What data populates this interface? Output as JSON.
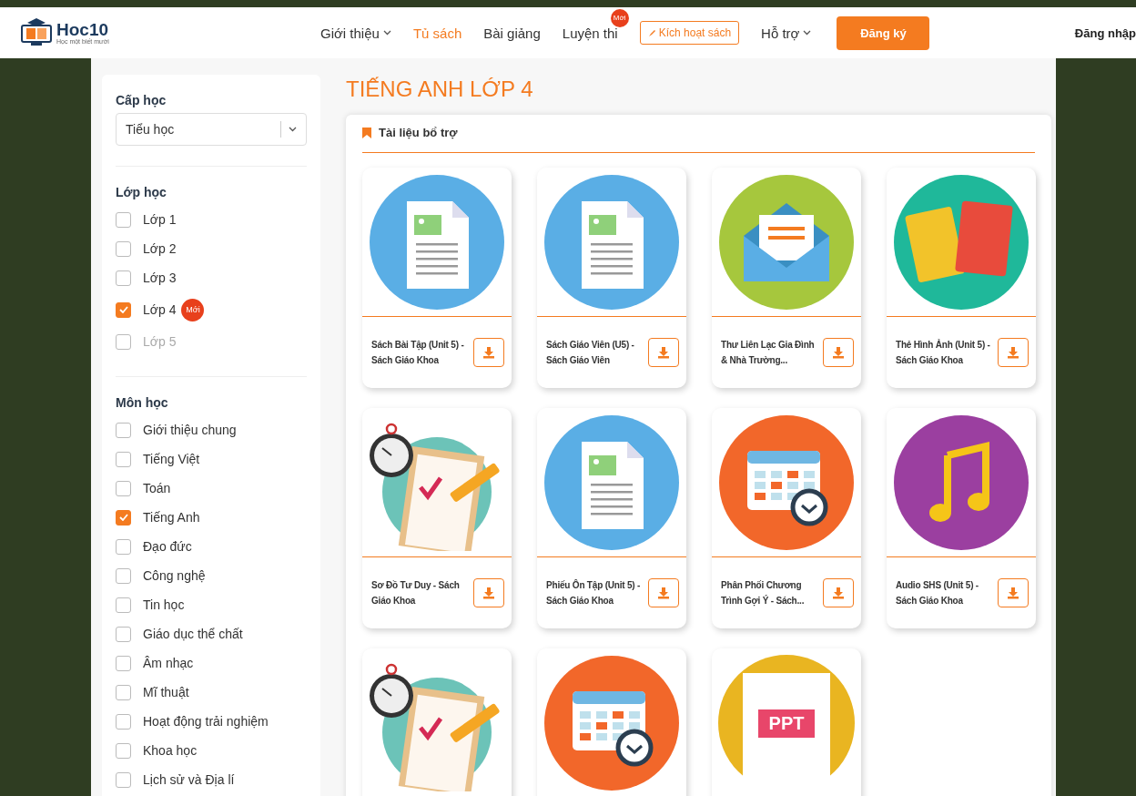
{
  "header": {
    "logo": {
      "name": "Hoc10",
      "tagline": "Học một biết mười"
    },
    "nav": [
      {
        "label": "Giới thiệu",
        "kind": "dropdown",
        "selected": false
      },
      {
        "label": "Tủ sách",
        "kind": "link",
        "selected": true
      },
      {
        "label": "Bài giảng",
        "kind": "link",
        "selected": false
      },
      {
        "label": "Luyện thi",
        "kind": "link",
        "selected": false,
        "badge": "Mới"
      },
      {
        "label": "Kích hoạt sách",
        "kind": "outline"
      },
      {
        "label": "Hỗ trợ",
        "kind": "dropdown",
        "selected": false
      }
    ],
    "register": "Đăng ký",
    "login": "Đăng nhập"
  },
  "sidebar": {
    "level": {
      "title": "Cấp học",
      "value": "Tiểu học"
    },
    "grades": {
      "title": "Lớp học",
      "items": [
        {
          "label": "Lớp 1",
          "checked": false,
          "disabled": false
        },
        {
          "label": "Lớp 2",
          "checked": false,
          "disabled": false
        },
        {
          "label": "Lớp 3",
          "checked": false,
          "disabled": false
        },
        {
          "label": "Lớp 4",
          "checked": true,
          "disabled": false,
          "badge": "Mới"
        },
        {
          "label": "Lớp 5",
          "checked": false,
          "disabled": true
        }
      ]
    },
    "subjects": {
      "title": "Môn học",
      "items": [
        {
          "label": "Giới thiệu chung",
          "checked": false
        },
        {
          "label": "Tiếng Việt",
          "checked": false
        },
        {
          "label": "Toán",
          "checked": false
        },
        {
          "label": "Tiếng Anh",
          "checked": true
        },
        {
          "label": "Đạo đức",
          "checked": false
        },
        {
          "label": "Công nghệ",
          "checked": false
        },
        {
          "label": "Tin học",
          "checked": false
        },
        {
          "label": "Giáo dục thể chất",
          "checked": false
        },
        {
          "label": "Âm nhạc",
          "checked": false
        },
        {
          "label": "Mĩ thuật",
          "checked": false
        },
        {
          "label": "Hoạt động trải nghiệm",
          "checked": false
        },
        {
          "label": "Khoa học",
          "checked": false
        },
        {
          "label": "Lịch sử và Địa lí",
          "checked": false
        }
      ]
    }
  },
  "page_title": "TIẾNG ANH LỚP 4",
  "section": {
    "title": "Tài liệu bổ trợ",
    "items": [
      {
        "kind": "document",
        "title": "Sách Bài Tập (Unit 5) - Sách Giáo Khoa"
      },
      {
        "kind": "document",
        "title": "Sách Giáo Viên (U5) - Sách Giáo Viên"
      },
      {
        "kind": "letter",
        "title": "Thư Liên Lạc Gia Đình & Nhà Trường..."
      },
      {
        "kind": "cards",
        "title": "Thẻ Hình Ảnh (Unit 5) - Sách Giáo Khoa"
      },
      {
        "kind": "checklist",
        "title": "Sơ Đồ Tư Duy - Sách Giáo Khoa"
      },
      {
        "kind": "document",
        "title": "Phiếu Ôn Tập (Unit 5) - Sách Giáo Khoa"
      },
      {
        "kind": "calendar",
        "title": "Phân Phối Chương Trình Gợi Ý - Sách..."
      },
      {
        "kind": "music",
        "title": "Audio SHS (Unit 5) - Sách Giáo Khoa"
      },
      {
        "kind": "checklist"
      },
      {
        "kind": "calendar"
      },
      {
        "kind": "ppt",
        "icon_text": "PPT"
      }
    ]
  }
}
